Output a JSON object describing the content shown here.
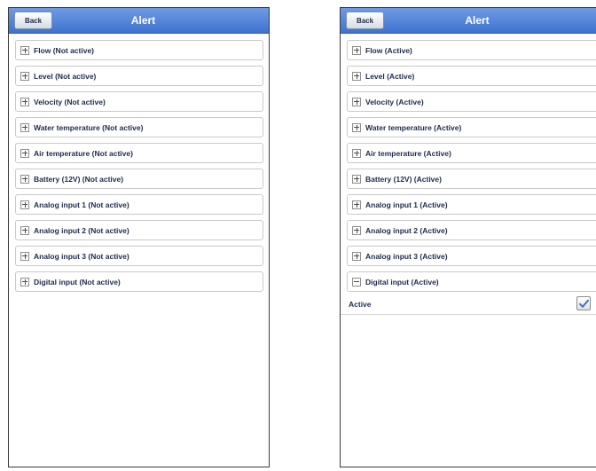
{
  "left_screen": {
    "back_label": "Back",
    "title": "Alert",
    "items": [
      {
        "label": "Flow (Not active)"
      },
      {
        "label": "Level (Not active)"
      },
      {
        "label": "Velocity (Not active)"
      },
      {
        "label": "Water temperature (Not active)"
      },
      {
        "label": "Air temperature (Not active)"
      },
      {
        "label": "Battery (12V) (Not active)"
      },
      {
        "label": "Analog input 1 (Not active)"
      },
      {
        "label": "Analog input 2 (Not active)"
      },
      {
        "label": "Analog input 3 (Not active)"
      },
      {
        "label": "Digital input (Not active)"
      }
    ]
  },
  "right_screen": {
    "back_label": "Back",
    "title": "Alert",
    "items": [
      {
        "label": "Flow (Active)"
      },
      {
        "label": "Level (Active)"
      },
      {
        "label": "Velocity (Active)"
      },
      {
        "label": "Water temperature (Active)"
      },
      {
        "label": "Air temperature (Active)"
      },
      {
        "label": "Battery (12V) (Active)"
      },
      {
        "label": "Analog input 1 (Active)"
      },
      {
        "label": "Analog input 2 (Active)"
      },
      {
        "label": "Analog input 3 (Active)"
      },
      {
        "label": "Digital input (Active)"
      }
    ],
    "expanded": {
      "active_label": "Active",
      "active_checked": true
    }
  },
  "colors": {
    "titlebar": "#4f82d8",
    "text": "#1d2b4d",
    "check": "#3f73c9"
  },
  "icons": {
    "collapsed": "plus-box-icon",
    "expanded": "minus-box-icon",
    "checkbox": "checkmark-icon"
  }
}
